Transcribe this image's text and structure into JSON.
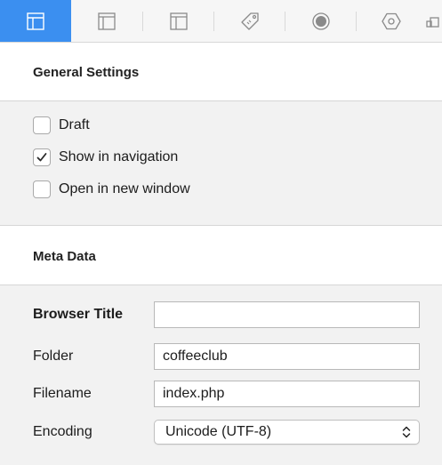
{
  "toolbar": {
    "tabs": [
      {
        "icon": "layout-icon",
        "active": true
      },
      {
        "icon": "layout-sidebar-icon",
        "active": false
      },
      {
        "icon": "layout-columns-icon",
        "active": false
      },
      {
        "icon": "tag-icon",
        "active": false
      },
      {
        "icon": "target-icon",
        "active": false
      },
      {
        "icon": "hexagon-icon",
        "active": false
      },
      {
        "icon": "modules-icon",
        "active": false
      }
    ],
    "accent_color": "#3b8ff0"
  },
  "general": {
    "title": "General Settings",
    "options": [
      {
        "label": "Draft",
        "checked": false
      },
      {
        "label": "Show in navigation",
        "checked": true
      },
      {
        "label": "Open in new window",
        "checked": false
      }
    ]
  },
  "meta": {
    "title": "Meta Data",
    "browser_title": {
      "label": "Browser Title",
      "value": ""
    },
    "folder": {
      "label": "Folder",
      "value": "coffeeclub"
    },
    "filename": {
      "label": "Filename",
      "value": "index.php"
    },
    "encoding": {
      "label": "Encoding",
      "value": "Unicode (UTF-8)"
    }
  }
}
